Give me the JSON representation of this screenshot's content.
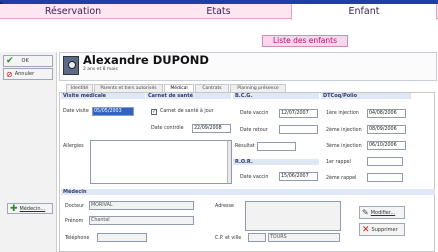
{
  "tabs": [
    {
      "label": "Réservation",
      "selected": false
    },
    {
      "label": "Etats",
      "selected": false
    },
    {
      "label": "Enfant",
      "selected": true
    }
  ],
  "liste_button": "Liste des enfants",
  "actions": {
    "ok": "OK",
    "annuler": "Annuler",
    "medecin": "Médecin..."
  },
  "child": {
    "name": "Alexandre DUPOND",
    "age": "2 ans et 8 mois"
  },
  "subtabs": [
    "Identité",
    "Parents et tiers autorisés",
    "Médical",
    "Contrats",
    "Planning présence"
  ],
  "visite": {
    "title": "Visite médicale",
    "date_label": "Date visite",
    "date_value": "05/05/2003"
  },
  "carnet": {
    "title": "Carnet de santé",
    "checkbox_label": "Carnet de santé à jour",
    "checked": true,
    "controle_label": "Date contrôle",
    "controle_value": "22/09/2008"
  },
  "bcg": {
    "title": "B.C.G.",
    "vaccin_label": "Date vaccin",
    "vaccin_value": "12/07/2007",
    "retour_label": "Date retour",
    "retour_value": "",
    "resultat_label": "Résultat",
    "resultat_value": ""
  },
  "ror": {
    "title": "R.O.R.",
    "vaccin_label": "Date vaccin",
    "vaccin_value": "15/06/2007"
  },
  "dtcoq": {
    "title": "DTCoq/Polio",
    "rows": [
      {
        "label": "1ère injection",
        "value": "04/08/2006"
      },
      {
        "label": "2ème injection",
        "value": "08/09/2006"
      },
      {
        "label": "3ème injection",
        "value": "06/10/2006"
      },
      {
        "label": "1er rappel",
        "value": ""
      },
      {
        "label": "2ème rappel",
        "value": ""
      }
    ]
  },
  "allergies_label": "Allergies",
  "medecin_section": {
    "title": "Médecin",
    "docteur_label": "Docteur",
    "docteur_value": "MORIVAL",
    "prenom_label": "Prénom",
    "prenom_value": "Chantal",
    "telephone_label": "Téléphone",
    "telephone_value": "",
    "adresse_label": "Adresse",
    "cp_label": "C.P. et ville",
    "cp_value": "",
    "ville_value": "TOURS",
    "modifier": "Modifier...",
    "supprimer": "Supprimer"
  },
  "colors": {
    "tabs_bg": "#fde6f2",
    "accent": "#b0126e",
    "selected_field": "#2f63c6",
    "section": "#dfe6f4"
  }
}
